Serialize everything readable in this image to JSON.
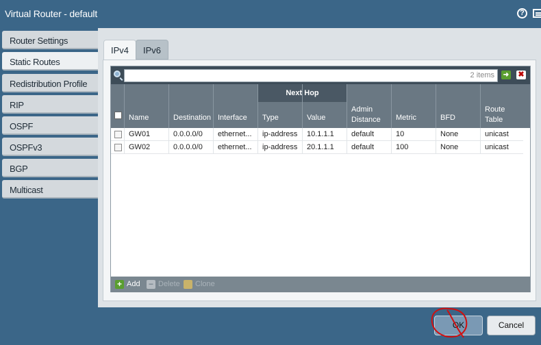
{
  "window": {
    "title": "Virtual Router - default",
    "help_icon": "help-icon",
    "help_glyph": "?",
    "panel_icon": "panel-icon"
  },
  "sidebar": {
    "items": [
      {
        "label": "Router Settings",
        "active": false
      },
      {
        "label": "Static Routes",
        "active": true
      },
      {
        "label": "Redistribution Profile",
        "active": false
      },
      {
        "label": "RIP",
        "active": false
      },
      {
        "label": "OSPF",
        "active": false
      },
      {
        "label": "OSPFv3",
        "active": false
      },
      {
        "label": "BGP",
        "active": false
      },
      {
        "label": "Multicast",
        "active": false
      }
    ]
  },
  "tabs": [
    {
      "label": "IPv4",
      "active": true
    },
    {
      "label": "IPv6",
      "active": false
    }
  ],
  "search": {
    "placeholder": "",
    "count_text": "2 items",
    "apply_glyph": "➜",
    "clear_glyph": "✖"
  },
  "table": {
    "group_header": "Next Hop",
    "columns": [
      "Name",
      "Destination",
      "Interface",
      "Type",
      "Value",
      "Admin Distance",
      "Metric",
      "BFD",
      "Route Table"
    ],
    "admin_distance_lines": [
      "Admin",
      "Distance"
    ],
    "route_table_lines": [
      "Route",
      "Table"
    ],
    "rows": [
      {
        "name": "GW01",
        "destination": "0.0.0.0/0",
        "interface": "ethernet...",
        "type": "ip-address",
        "value": "10.1.1.1",
        "admin_distance": "default",
        "metric": "10",
        "bfd": "None",
        "route_table": "unicast"
      },
      {
        "name": "GW02",
        "destination": "0.0.0.0/0",
        "interface": "ethernet...",
        "type": "ip-address",
        "value": "20.1.1.1",
        "admin_distance": "default",
        "metric": "100",
        "bfd": "None",
        "route_table": "unicast"
      }
    ]
  },
  "toolbar": {
    "add_label": "Add",
    "delete_label": "Delete",
    "clone_label": "Clone",
    "add_glyph": "+",
    "delete_glyph": "−"
  },
  "footer": {
    "ok_label": "OK",
    "cancel_label": "Cancel"
  },
  "colors": {
    "frame": "#3b6688",
    "header": "#6a7883",
    "add_icon": "#5a9e2f",
    "annotation": "#d01010"
  }
}
